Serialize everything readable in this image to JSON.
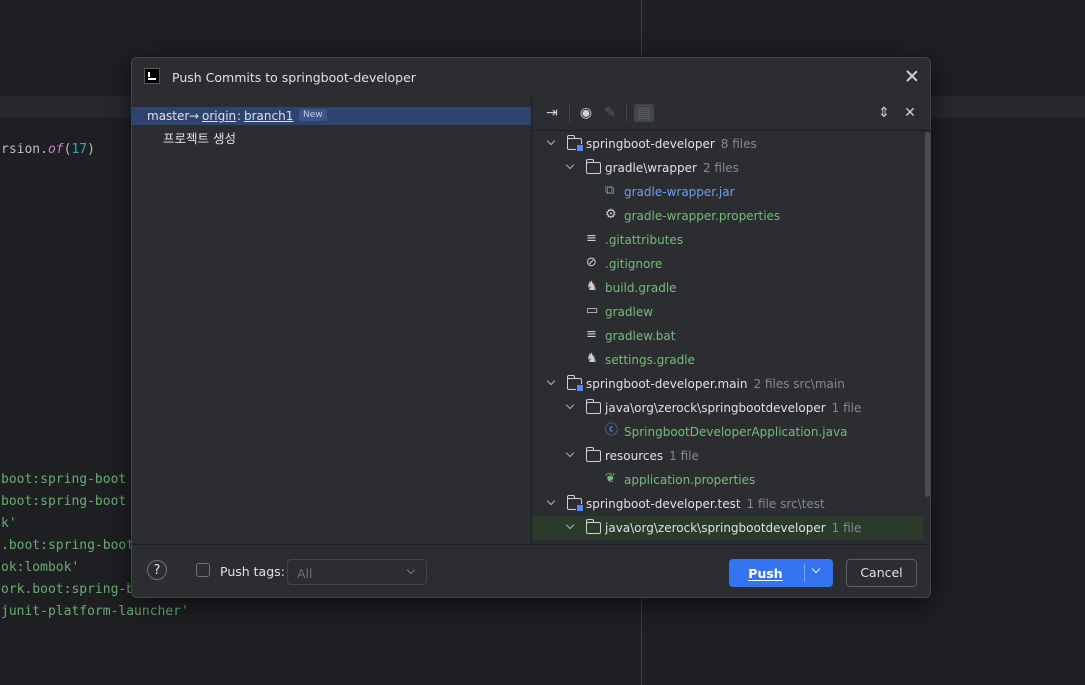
{
  "editor": {
    "code_lines": [
      {
        "parts": [
          {
            "t": "rsion.",
            "c": "p"
          },
          {
            "t": "of",
            "c": "i"
          },
          {
            "t": "(",
            "c": "p"
          },
          {
            "t": "17",
            "c": "n"
          },
          {
            "t": ")",
            "c": "p"
          }
        ]
      },
      {
        "parts": [
          {
            "t": "boot:spring-boot",
            "c": "s"
          }
        ]
      },
      {
        "parts": [
          {
            "t": "boot:spring-boot",
            "c": "s"
          }
        ]
      },
      {
        "parts": [
          {
            "t": "k'",
            "c": "s"
          }
        ]
      },
      {
        "parts": [
          {
            "t": ".boot:spring-boot",
            "c": "s"
          }
        ]
      },
      {
        "parts": [
          {
            "t": "ok:lombok'",
            "c": "s"
          }
        ]
      },
      {
        "parts": [
          {
            "t": "ork.boot:spring-b",
            "c": "s"
          }
        ]
      },
      {
        "parts": [
          {
            "t": "junit-platform-launcher'",
            "c": "s"
          }
        ]
      }
    ]
  },
  "dialog": {
    "title": "Push Commits to springboot-developer",
    "branch": {
      "local": "master",
      "arrow": "→",
      "remote": "origin",
      "colon": ":",
      "target": "branch1",
      "badge": "New"
    },
    "commit_message": "프로젝트 생성",
    "tree": [
      {
        "name": "springboot-developer",
        "meta": "8 files",
        "kind": "module",
        "level": 0,
        "expanded": true
      },
      {
        "name": "gradle\\wrapper",
        "meta": "2 files",
        "kind": "folder",
        "level": 1,
        "expanded": true
      },
      {
        "name": "gradle-wrapper.jar",
        "meta": "",
        "kind": "jar",
        "level": 2
      },
      {
        "name": "gradle-wrapper.properties",
        "meta": "",
        "kind": "gear",
        "level": 2
      },
      {
        "name": ".gitattributes",
        "meta": "",
        "kind": "text",
        "level": 1
      },
      {
        "name": ".gitignore",
        "meta": "",
        "kind": "ignore",
        "level": 1
      },
      {
        "name": "build.gradle",
        "meta": "",
        "kind": "gradle",
        "level": 1
      },
      {
        "name": "gradlew",
        "meta": "",
        "kind": "shell",
        "level": 1
      },
      {
        "name": "gradlew.bat",
        "meta": "",
        "kind": "text",
        "level": 1
      },
      {
        "name": "settings.gradle",
        "meta": "",
        "kind": "gradle",
        "level": 1
      },
      {
        "name": "springboot-developer.main",
        "meta": "2 files  src\\main",
        "kind": "module",
        "level": 0,
        "expanded": true
      },
      {
        "name": "java\\org\\zerock\\springbootdeveloper",
        "meta": "1 file",
        "kind": "folder",
        "level": 1,
        "expanded": true
      },
      {
        "name": "SpringbootDeveloperApplication.java",
        "meta": "",
        "kind": "java",
        "level": 2
      },
      {
        "name": "resources",
        "meta": "1 file",
        "kind": "folder",
        "level": 1,
        "expanded": true
      },
      {
        "name": "application.properties",
        "meta": "",
        "kind": "leaf",
        "level": 2
      },
      {
        "name": "springboot-developer.test",
        "meta": "1 file  src\\test",
        "kind": "module",
        "level": 0,
        "expanded": true
      },
      {
        "name": "java\\org\\zerock\\springbootdeveloper",
        "meta": "1 file",
        "kind": "folder",
        "level": 1,
        "expanded": true,
        "highlight": true
      }
    ],
    "footer": {
      "help": "?",
      "push_tags_label": "Push tags:",
      "tags_select_value": "All",
      "push_label": "Push",
      "cancel_label": "Cancel"
    }
  }
}
